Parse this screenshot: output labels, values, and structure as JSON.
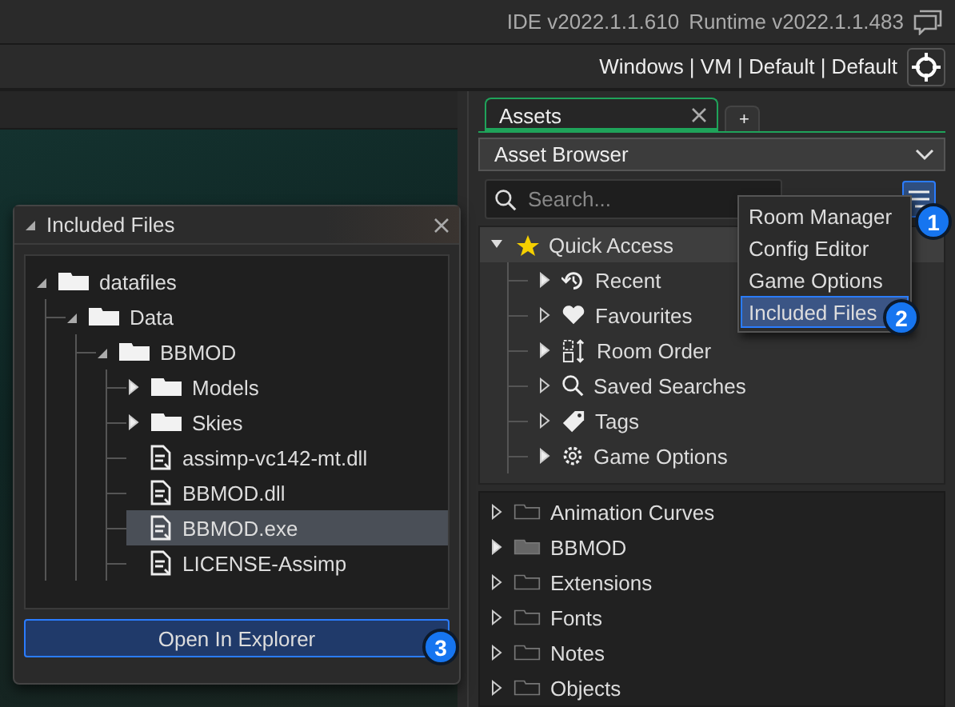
{
  "header": {
    "ide_version": "IDE v2022.1.1.610",
    "runtime_version": "Runtime v2022.1.1.483"
  },
  "target_bar": {
    "text": "Windows | VM | Default | Default"
  },
  "assets_panel": {
    "tabs": [
      {
        "label": "Assets",
        "selected": true,
        "closable": true
      },
      {
        "label": "+",
        "selected": false,
        "closable": false
      }
    ],
    "dropdown": "Asset Browser",
    "search": {
      "placeholder": "Search..."
    },
    "menu_button": {
      "active": true,
      "badge": "1"
    },
    "quick_access": {
      "label": "Quick Access",
      "expanded": true,
      "children": [
        {
          "label": "Recent",
          "kind": "recent",
          "has_children": true
        },
        {
          "label": "Favourites",
          "kind": "heart",
          "has_children": false
        },
        {
          "label": "Room Order",
          "kind": "room-order",
          "has_children": true
        },
        {
          "label": "Saved Searches",
          "kind": "search",
          "has_children": false
        },
        {
          "label": "Tags",
          "kind": "tag",
          "has_children": false
        },
        {
          "label": "Game Options",
          "kind": "gear",
          "has_children": true
        }
      ]
    },
    "groups": [
      {
        "label": "Animation Curves",
        "has_children": false
      },
      {
        "label": "BBMOD",
        "has_children": true
      },
      {
        "label": "Extensions",
        "has_children": false
      },
      {
        "label": "Fonts",
        "has_children": false
      },
      {
        "label": "Notes",
        "has_children": false
      },
      {
        "label": "Objects",
        "has_children": false
      }
    ]
  },
  "menu": {
    "items": [
      {
        "label": "Room Manager",
        "selected": false
      },
      {
        "label": "Config Editor",
        "selected": false
      },
      {
        "label": "Game Options",
        "selected": false
      },
      {
        "label": "Included Files",
        "selected": true,
        "badge": "2"
      }
    ]
  },
  "included_files": {
    "title": "Included Files",
    "tree": [
      {
        "label": "datafiles",
        "kind": "folder",
        "expanded": true,
        "selected": false,
        "children": [
          {
            "label": "Data",
            "kind": "folder",
            "expanded": true,
            "selected": false,
            "children": [
              {
                "label": "BBMOD",
                "kind": "folder",
                "expanded": true,
                "selected": false,
                "children": [
                  {
                    "label": "Models",
                    "kind": "folder",
                    "expanded": false,
                    "selected": false
                  },
                  {
                    "label": "Skies",
                    "kind": "folder",
                    "expanded": false,
                    "selected": false
                  },
                  {
                    "label": "assimp-vc142-mt.dll",
                    "kind": "file",
                    "selected": false
                  },
                  {
                    "label": "BBMOD.dll",
                    "kind": "file",
                    "selected": false
                  },
                  {
                    "label": "BBMOD.exe",
                    "kind": "file",
                    "selected": true
                  },
                  {
                    "label": "LICENSE-Assimp",
                    "kind": "file",
                    "selected": false
                  }
                ]
              }
            ]
          }
        ]
      }
    ],
    "button": {
      "label": "Open In Explorer",
      "badge": "3"
    }
  }
}
